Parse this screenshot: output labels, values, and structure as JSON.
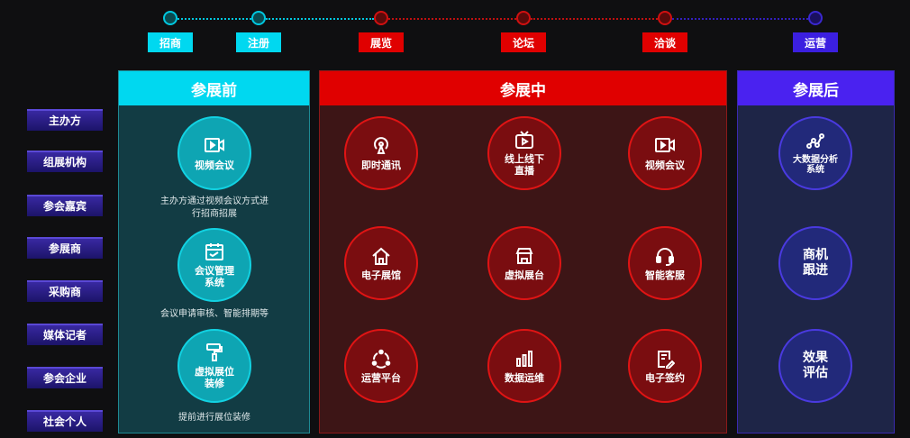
{
  "timeline": {
    "steps": [
      {
        "label": "招商",
        "color": "#00d8f0",
        "text_color": "#ffffff"
      },
      {
        "label": "注册",
        "color": "#00d8f0",
        "text_color": "#ffffff"
      },
      {
        "label": "展览",
        "color": "#e00000",
        "text_color": "#ffffff"
      },
      {
        "label": "论坛",
        "color": "#e00000",
        "text_color": "#ffffff"
      },
      {
        "label": "洽谈",
        "color": "#e00000",
        "text_color": "#ffffff"
      },
      {
        "label": "运营",
        "color": "#3b1fe0",
        "text_color": "#ffffff"
      }
    ]
  },
  "roles": [
    "主办方",
    "组展机构",
    "参会嘉宾",
    "参展商",
    "采购商",
    "媒体记者",
    "参会企业",
    "社会个人"
  ],
  "before": {
    "title": "参展前",
    "header_color": "#00d8f0",
    "items": [
      {
        "label": "视频会议",
        "icon": "video-icon",
        "desc": "主办方通过视频会议方式进行招商招展"
      },
      {
        "label": "会议管理\n系统",
        "icon": "calendar-icon",
        "desc": "会议申请审核、智能排期等"
      },
      {
        "label": "虚拟展位\n装修",
        "icon": "paint-roller-icon",
        "desc": "提前进行展位装修"
      }
    ]
  },
  "during": {
    "title": "参展中",
    "header_color": "#e00000",
    "items": [
      {
        "label": "即时通讯",
        "icon": "broadcast-icon"
      },
      {
        "label": "线上线下\n直播",
        "icon": "tv-icon"
      },
      {
        "label": "视频会议",
        "icon": "video-icon"
      },
      {
        "label": "电子展馆",
        "icon": "house-icon"
      },
      {
        "label": "虚拟展台",
        "icon": "booth-icon"
      },
      {
        "label": "智能客服",
        "icon": "headset-icon"
      },
      {
        "label": "运营平台",
        "icon": "cycle-icon"
      },
      {
        "label": "数据运维",
        "icon": "bar-chart-icon"
      },
      {
        "label": "电子签约",
        "icon": "contract-icon"
      }
    ]
  },
  "after": {
    "title": "参展后",
    "header_color": "#4a22f0",
    "items": [
      {
        "label": "大数据分析\n系统",
        "icon": "analytics-icon"
      },
      {
        "label": "商机\n跟进"
      },
      {
        "label": "效果\n评估"
      }
    ]
  }
}
